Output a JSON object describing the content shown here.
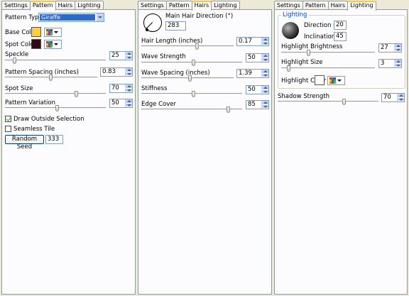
{
  "panel_pattern": {
    "tabs": [
      "Settings",
      "Pattern",
      "Hairs",
      "Lighting"
    ],
    "active_tab": "Pattern",
    "pattern_type_label": "Pattern Type:",
    "pattern_type_value": "Giraffe",
    "base_color_label": "Base Color",
    "base_color": "#ffcc44",
    "spot_color_label": "Spot Color",
    "spot_color": "#330a12",
    "speckle_label": "Speckle",
    "speckle_value": "25",
    "pattern_spacing_label": "Pattern Spacing (inches)",
    "pattern_spacing_value": "0.83",
    "spot_size_label": "Spot Size",
    "spot_size_value": "70",
    "pattern_variation_label": "Pattern Variation",
    "pattern_variation_value": "50",
    "draw_outside_label": "Draw Outside Selection",
    "seamless_tile_label": "Seamless Tile",
    "random_seed_label": "Random Seed",
    "random_seed_value": "333"
  },
  "panel_hairs": {
    "tabs": [
      "Settings",
      "Pattern",
      "Hairs",
      "Lighting"
    ],
    "active_tab": "Hairs",
    "direction_label": "Main Hair Direction (°)",
    "direction_value": "283",
    "hair_length_label": "Hair Length (inches)",
    "hair_length_value": "0.17",
    "wave_strength_label": "Wave Strength",
    "wave_strength_value": "50",
    "wave_spacing_label": "Wave Spacing (inches)",
    "wave_spacing_value": "1.39",
    "stiffness_label": "Stiffness",
    "stiffness_value": "50",
    "edge_cover_label": "Edge Cover",
    "edge_cover_value": "85"
  },
  "panel_lighting": {
    "tabs": [
      "Settings",
      "Pattern",
      "Hairs",
      "Lighting"
    ],
    "active_tab": "Lighting",
    "group_label": "Lighting",
    "direction_label": "Direction (°)",
    "direction_value": "20",
    "inclination_label": "Inclination (°)",
    "inclination_value": "45",
    "highlight_brightness_label": "Highlight Brightness",
    "highlight_brightness_value": "27",
    "highlight_size_label": "Highlight Size",
    "highlight_size_value": "3",
    "highlight_color_label": "Highlight Color",
    "highlight_color": "#ffffff",
    "shadow_strength_label": "Shadow Strength",
    "shadow_strength_value": "70"
  }
}
